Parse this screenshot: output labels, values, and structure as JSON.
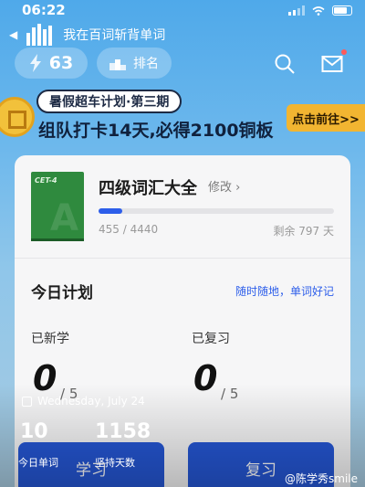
{
  "status": {
    "time": "06:22"
  },
  "back": {
    "text": "我在百词斩背单词"
  },
  "top": {
    "streak": "63",
    "rank_label": "排名"
  },
  "banner": {
    "tag": "暑假超车计划·第三期",
    "headline": "组队打卡14天,必得2100铜板",
    "go": "点击前往>>"
  },
  "book": {
    "cover_tag": "CET-4",
    "name": "四级词汇大全",
    "edit": "修改 ›",
    "progress_text": "455 / 4440",
    "progress_fraction": 0.1025,
    "remaining": "剩余 797 天"
  },
  "plan": {
    "title": "今日计划",
    "slogan": "随时随地，单词好记",
    "new_label": "已新学",
    "review_label": "已复习",
    "new_done": "0",
    "new_total": "/ 5",
    "review_done": "0",
    "review_total": "/ 5",
    "learn_btn": "学习",
    "review_btn": "复习"
  },
  "overlay": {
    "date": "Wednesday, July 24",
    "today_words": "10",
    "today_words_label": "今日单词",
    "days": "1158",
    "days_label": "坚持天数",
    "watermark": "@陈学秀smile"
  },
  "colors": {
    "accent": "#2557d6",
    "banner_btn": "#f2b531",
    "book": "#2f8a3e"
  }
}
